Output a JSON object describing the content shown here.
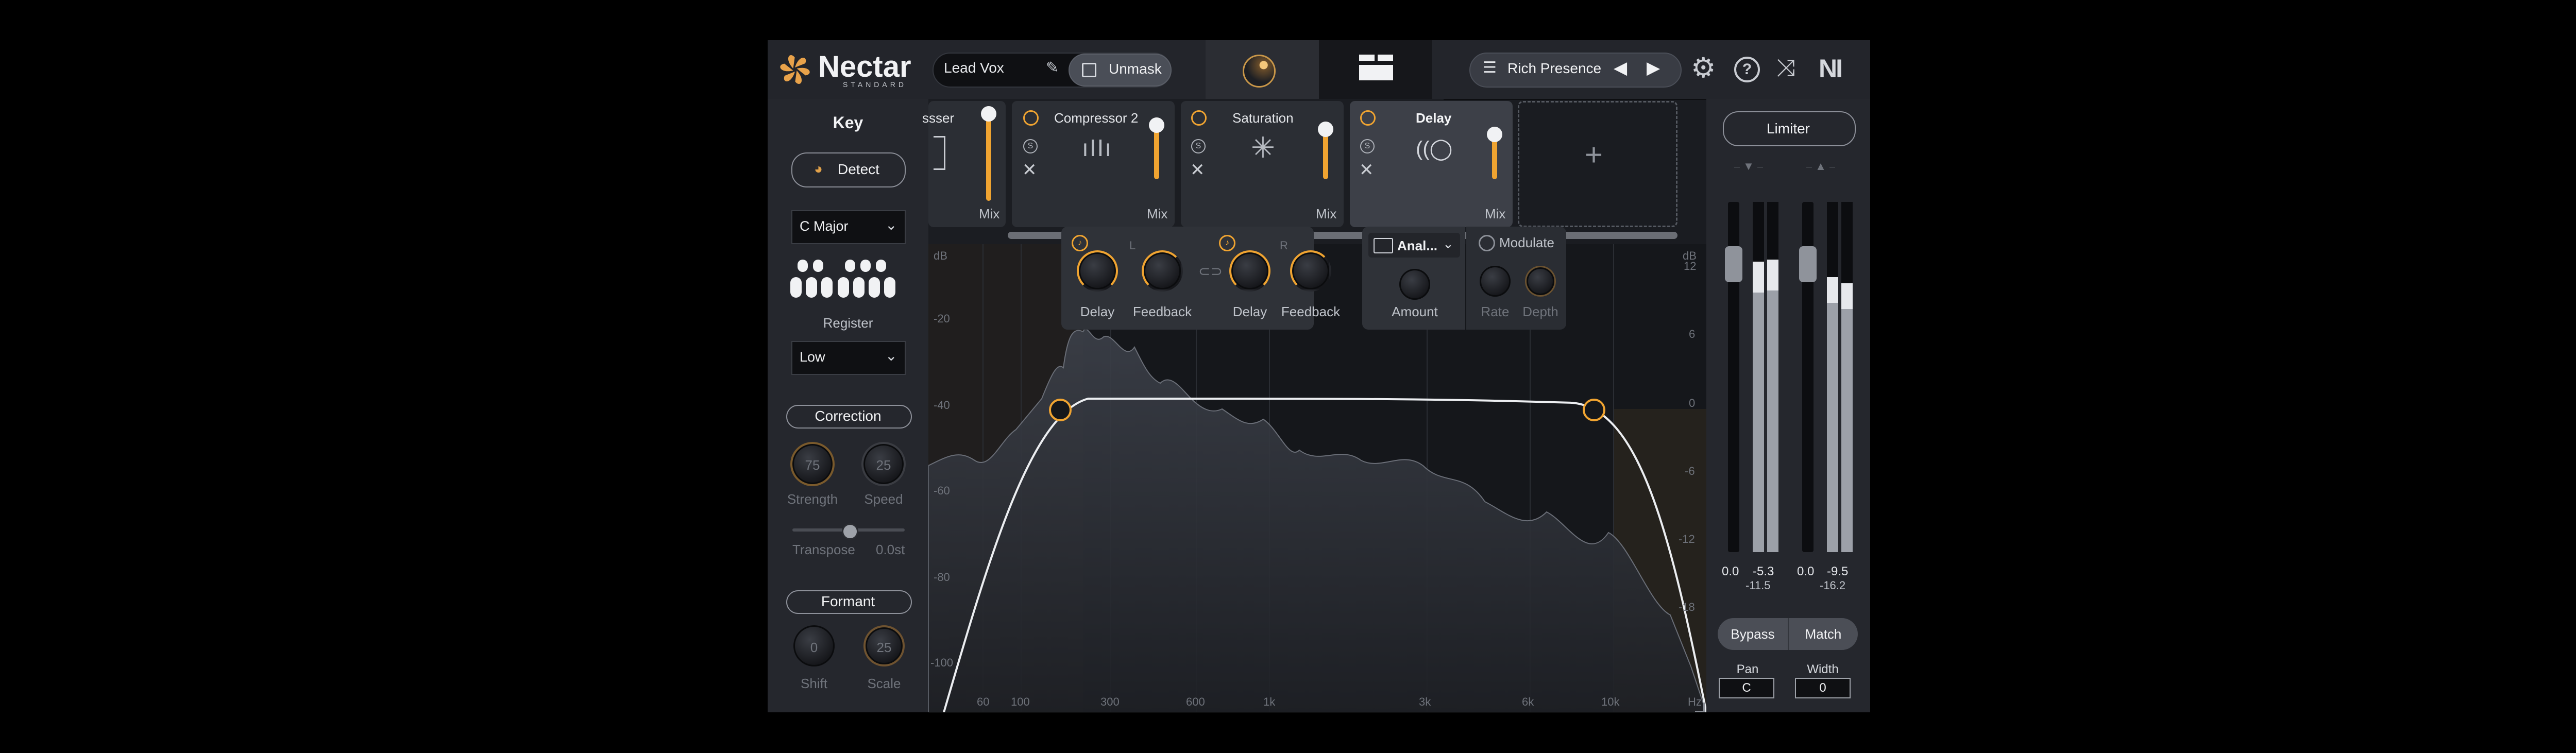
{
  "header": {
    "brand": "Nectar",
    "brand_sub": "STANDARD",
    "preset_name": "Lead Vox",
    "unmask_label": "Unmask",
    "preset_browser": "Rich Presence",
    "ni_logo": "NI"
  },
  "key_panel": {
    "title": "Key",
    "detect_label": "Detect",
    "scale_value": "C Major",
    "register_label": "Register",
    "register_value": "Low",
    "correction_label": "Correction",
    "strength_value": "75",
    "strength_label": "Strength",
    "speed_value": "25",
    "speed_label": "Speed",
    "transpose_label": "Transpose",
    "transpose_value": "0.0st",
    "formant_label": "Formant",
    "shift_value": "0",
    "shift_label": "Shift",
    "scale_knob_value": "25",
    "scale_knob_label": "Scale"
  },
  "modules": [
    {
      "name": "ssser",
      "mix": "Mix"
    },
    {
      "name": "Compressor 2",
      "mix": "Mix"
    },
    {
      "name": "Saturation",
      "mix": "Mix"
    },
    {
      "name": "Delay",
      "mix": "Mix"
    }
  ],
  "delay_controls": {
    "l_label": "L",
    "r_label": "R",
    "delay_label": "Delay",
    "feedback_label": "Feedback",
    "mode_value": "Anal...",
    "amount_label": "Amount",
    "modulate_label": "Modulate",
    "rate_label": "Rate",
    "depth_label": "Depth"
  },
  "eq": {
    "left_scale": [
      "dB",
      "-20",
      "-40",
      "-60",
      "-80",
      "-100"
    ],
    "right_scale": [
      "dB",
      "12",
      "6",
      "0",
      "-6",
      "-12",
      "-18"
    ],
    "freq_labels": [
      "60",
      "100",
      "300",
      "600",
      "1k",
      "3k",
      "6k",
      "10k",
      "Hz"
    ]
  },
  "right_panel": {
    "limiter_label": "Limiter",
    "meter_in": {
      "peak_l": "0.0",
      "peak_r": "-5.3",
      "rms": "-11.5"
    },
    "meter_out": {
      "peak_l": "0.0",
      "peak_r": "-9.5",
      "rms": "-16.2"
    },
    "bypass_label": "Bypass",
    "match_label": "Match",
    "pan_label": "Pan",
    "pan_value": "C",
    "width_label": "Width",
    "width_value": "0"
  },
  "colors": {
    "accent": "#f0a431",
    "bg": "#1a1c21",
    "panel": "#23252b"
  }
}
